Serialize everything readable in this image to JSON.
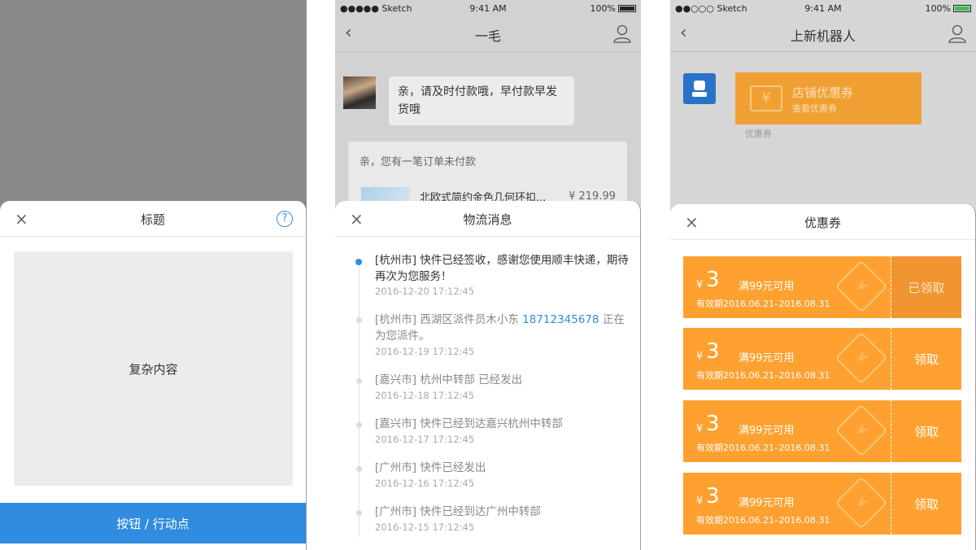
{
  "panel1": {
    "sheet_title": "标题",
    "close_label": "×",
    "help_label": "?",
    "content_label": "复杂内容",
    "action_label": "按钮 / 行动点"
  },
  "panel2": {
    "status": {
      "carrier": "●●●●● Sketch",
      "time": "9:41 AM",
      "battery": "100%"
    },
    "nav_title": "一毛",
    "back_label": "‹",
    "chat_message": "亲，请及时付款哦，早付款早发货哦",
    "order": {
      "notice": "亲，您有一笔订单未付款",
      "product": "北欧式简约金色几何环扣...",
      "price": "¥ 219.99"
    },
    "sheet_title": "物流消息",
    "close_label": "×",
    "timeline": [
      {
        "text": "[杭州市] 快件已经签收，感谢您使用顺丰快递，期待再次为您服务！",
        "time": "2016-12-20  17:12:45"
      },
      {
        "text_before": "[杭州市] 西湖区派件员木小东 ",
        "phone": "18712345678",
        "text_after": " 正在为您派件。",
        "time": "2016-12-19  17:12:45"
      },
      {
        "text": "[嘉兴市] 杭州中转部 已经发出",
        "time": "2016-12-18  17:12:45"
      },
      {
        "text": "[嘉兴市] 快件已经到达嘉兴杭州中转部",
        "time": "2016-12-17  17:12:45"
      },
      {
        "text": "[广州市] 快件已经发出",
        "time": "2016-12-16  17:12:45"
      },
      {
        "text": "[广州市] 快件已经到达广州中转部",
        "time": "2016-12-15  17:12:45"
      }
    ]
  },
  "panel3": {
    "status": {
      "carrier": "●●○○○ Sketch",
      "time": "9:41 AM",
      "battery": "100%"
    },
    "nav_title": "上新机器人",
    "back_label": "‹",
    "shop_coupon": {
      "title": "店铺优惠券",
      "subtitle": "查看优惠券",
      "icon": "¥"
    },
    "coupon_tag": "优惠券",
    "sheet_title": "优惠券",
    "close_label": "×",
    "coupons": [
      {
        "currency": "¥",
        "amount": "3",
        "condition": "满99元可用",
        "validity": "有效期2016.06.21–2016.08.31",
        "action": "已领取",
        "claimed": true
      },
      {
        "currency": "¥",
        "amount": "3",
        "condition": "满99元可用",
        "validity": "有效期2016.06.21–2016.08.31",
        "action": "领取",
        "claimed": false
      },
      {
        "currency": "¥",
        "amount": "3",
        "condition": "满99元可用",
        "validity": "有效期2016.06.21–2016.08.31",
        "action": "领取",
        "claimed": false
      },
      {
        "currency": "¥",
        "amount": "3",
        "condition": "满99元可用",
        "validity": "有效期2016.06.21–2016.08.31",
        "action": "领取",
        "claimed": false
      }
    ]
  },
  "colors": {
    "accent_blue": "#2f8ce0",
    "coupon_orange": "#fea130",
    "claimed_orange": "#f09530"
  }
}
